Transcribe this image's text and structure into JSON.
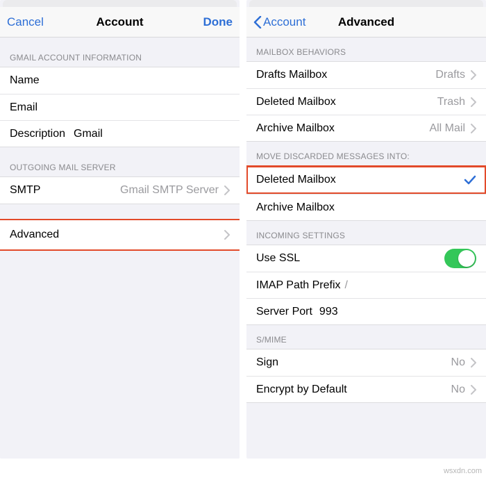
{
  "watermark": "wsxdn.com",
  "left_screen": {
    "nav": {
      "cancel": "Cancel",
      "title": "Account",
      "done": "Done"
    },
    "section_info_header": "GMAIL ACCOUNT INFORMATION",
    "info_rows": {
      "name_label": "Name",
      "email_label": "Email",
      "description_label": "Description",
      "description_value": "Gmail"
    },
    "section_outgoing_header": "OUTGOING MAIL SERVER",
    "smtp_label": "SMTP",
    "smtp_value": "Gmail SMTP Server",
    "advanced_label": "Advanced"
  },
  "right_screen": {
    "nav": {
      "back": "Account",
      "title": "Advanced"
    },
    "section_mailbox_header": "MAILBOX BEHAVIORS",
    "mailbox": {
      "drafts_label": "Drafts Mailbox",
      "drafts_value": "Drafts",
      "deleted_label": "Deleted Mailbox",
      "deleted_value": "Trash",
      "archive_label": "Archive Mailbox",
      "archive_value": "All Mail"
    },
    "section_discard_header": "MOVE DISCARDED MESSAGES INTO:",
    "discard": {
      "deleted_label": "Deleted Mailbox",
      "archive_label": "Archive Mailbox"
    },
    "section_incoming_header": "INCOMING SETTINGS",
    "incoming": {
      "ssl_label": "Use SSL",
      "imap_prefix_label": "IMAP Path Prefix",
      "imap_prefix_value": "/",
      "server_port_label": "Server Port",
      "server_port_value": "993"
    },
    "section_smime_header": "S/MIME",
    "smime": {
      "sign_label": "Sign",
      "sign_value": "No",
      "encrypt_label": "Encrypt by Default",
      "encrypt_value": "No"
    }
  }
}
